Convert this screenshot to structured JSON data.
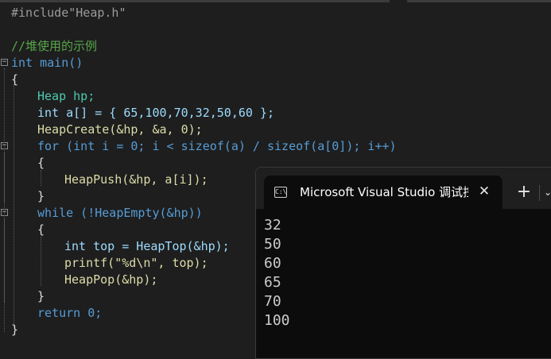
{
  "editor": {
    "lines": [
      "#include\"Heap.h\"",
      "",
      "//堆使用的示例",
      "int main()",
      "{",
      "Heap hp;",
      "int a[] = { 65,100,70,32,50,60 };",
      "HeapCreate(&hp, &a, 0);",
      "for (int i = 0; i < sizeof(a) / sizeof(a[0]); i++)",
      "{",
      "HeapPush(&hp, a[i]);",
      "}",
      "while (!HeapEmpty(&hp))",
      "{",
      "int top = HeapTop(&hp);",
      "printf(\"%d\\n\", top);",
      "HeapPop(&hp);",
      "}",
      "return 0;",
      "}"
    ]
  },
  "terminal": {
    "icon_glyph": "C:\\",
    "title": "Microsoft Visual Studio 调试控制台",
    "close_glyph": "✕",
    "add_glyph": "+",
    "dropdown_glyph": "⌄",
    "output": [
      "32",
      "50",
      "60",
      "65",
      "70",
      "100"
    ]
  },
  "icons": {
    "terminal": "console-app-icon",
    "close": "close-icon",
    "add": "new-tab-icon",
    "dropdown": "chevron-down-icon",
    "fold": "collapse-icon"
  },
  "colors": {
    "editor_bg": "#1e1e1e",
    "keyword": "#569cd6",
    "function": "#dcdcaa",
    "type": "#4ec9b0",
    "variable": "#9cdcfe",
    "number": "#b5cea8",
    "string": "#d69d85",
    "comment": "#57a64a",
    "terminal_bg": "#0c0c0c"
  }
}
